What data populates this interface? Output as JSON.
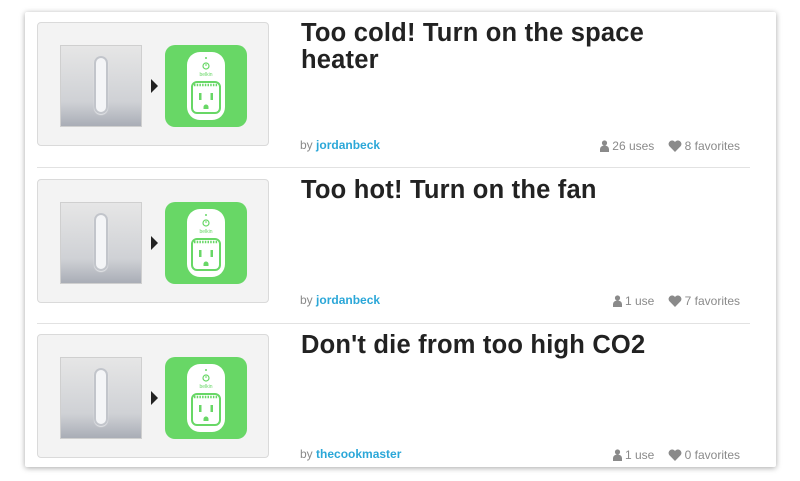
{
  "recipes": [
    {
      "title": "Too cold! Turn on the space heater",
      "by_label": "by",
      "author": "jordanbeck",
      "uses": "26 uses",
      "favorites": "8 favorites",
      "action_brand": "belkin"
    },
    {
      "title": "Too hot! Turn on the fan",
      "by_label": "by",
      "author": "jordanbeck",
      "uses": "1 use",
      "favorites": "7 favorites",
      "action_brand": "belkin"
    },
    {
      "title": "Don't die from too high CO2",
      "by_label": "by",
      "author": "thecookmaster",
      "uses": "1 use",
      "favorites": "0 favorites",
      "action_brand": "belkin"
    }
  ],
  "colors": {
    "accent_link": "#2ba7d8",
    "action_green": "#68d766",
    "title_text": "#222222",
    "muted_text": "#8a8a8a"
  },
  "icons": {
    "trigger": "wall-switch-icon",
    "arrow": "arrow-right-icon",
    "action": "smart-plug-icon",
    "uses": "user-icon",
    "favorites": "heart-icon"
  }
}
